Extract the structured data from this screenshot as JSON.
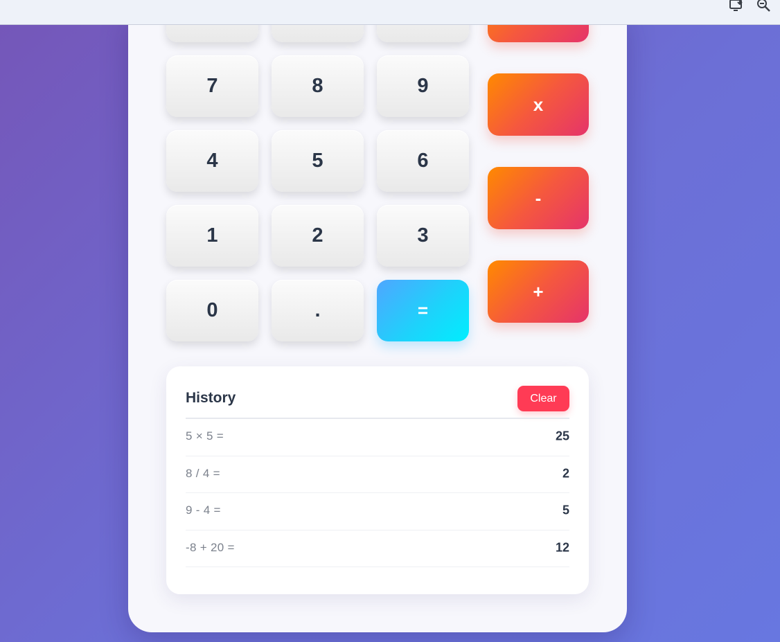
{
  "browser": {
    "icons": [
      "install-app-icon",
      "zoom-out-icon"
    ]
  },
  "keypad": {
    "top_row_partial": [
      "",
      "",
      "",
      ""
    ],
    "row1": [
      "7",
      "8",
      "9"
    ],
    "row2": [
      "4",
      "5",
      "6"
    ],
    "row3": [
      "1",
      "2",
      "3"
    ],
    "row4": [
      "0",
      ".",
      "="
    ],
    "operators": [
      "x",
      "-",
      "+"
    ]
  },
  "history": {
    "title": "History",
    "clear_label": "Clear",
    "entries": [
      {
        "expression": "5 × 5 =",
        "result": "25"
      },
      {
        "expression": "8 / 4 =",
        "result": "2"
      },
      {
        "expression": "9 - 4 =",
        "result": "5"
      },
      {
        "expression": "-8 + 20 =",
        "result": "12"
      }
    ]
  },
  "colors": {
    "operator_gradient": [
      "#ff8a00",
      "#e5346a"
    ],
    "equals_gradient": [
      "#4fa6ff",
      "#00eefe"
    ],
    "clear_button": "#ff3b55",
    "text_dark": "#2b3648"
  }
}
